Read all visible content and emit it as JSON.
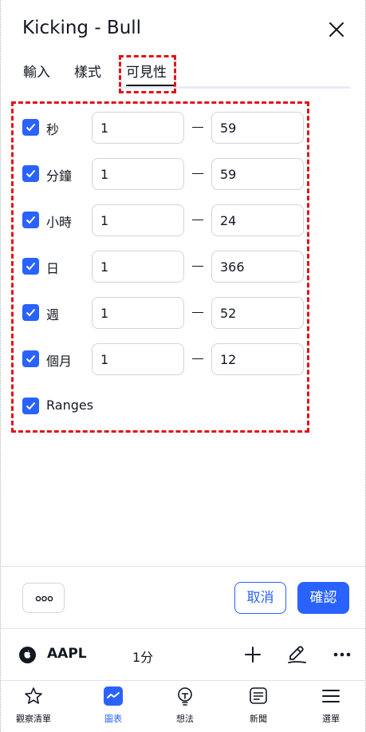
{
  "dialog": {
    "title": "Kicking - Bull"
  },
  "tabs": [
    {
      "label": "輸入"
    },
    {
      "label": "樣式"
    },
    {
      "label": "可見性",
      "active": true
    }
  ],
  "visibility_rows": [
    {
      "label": "秒",
      "checked": true,
      "from": "1",
      "to": "59"
    },
    {
      "label": "分鐘",
      "checked": true,
      "from": "1",
      "to": "59"
    },
    {
      "label": "小時",
      "checked": true,
      "from": "1",
      "to": "24"
    },
    {
      "label": "日",
      "checked": true,
      "from": "1",
      "to": "366"
    },
    {
      "label": "週",
      "checked": true,
      "from": "1",
      "to": "52"
    },
    {
      "label": "個月",
      "checked": true,
      "from": "1",
      "to": "12"
    },
    {
      "label": "Ranges",
      "checked": true
    }
  ],
  "footer": {
    "more_icon": "ellipsis-icon",
    "cancel_label": "取消",
    "ok_label": "確認"
  },
  "symbol_bar": {
    "symbol": "AAPL",
    "interval": "1分",
    "icons": [
      "apple-logo-icon",
      "plus-icon",
      "pen-icon",
      "more-icon"
    ]
  },
  "bottom_nav": [
    {
      "label": "觀察清單",
      "icon": "star-icon"
    },
    {
      "label": "圖表",
      "icon": "chart-icon",
      "active": true
    },
    {
      "label": "想法",
      "icon": "lightbulb-icon"
    },
    {
      "label": "新聞",
      "icon": "news-icon"
    },
    {
      "label": "選單",
      "icon": "menu-icon"
    }
  ],
  "colors": {
    "accent": "#2962ff",
    "text": "#131722",
    "highlight": "#e0141a"
  }
}
